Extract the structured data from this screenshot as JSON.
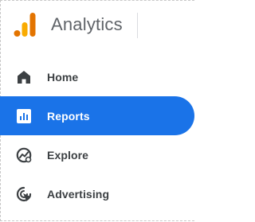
{
  "header": {
    "title": "Analytics",
    "logo_icon": "analytics-logo-icon",
    "logo_colors": [
      "#f9ab00",
      "#e37400"
    ]
  },
  "nav": {
    "items": [
      {
        "label": "Home",
        "icon": "home-icon",
        "active": false
      },
      {
        "label": "Reports",
        "icon": "reports-icon",
        "active": true
      },
      {
        "label": "Explore",
        "icon": "explore-icon",
        "active": false
      },
      {
        "label": "Advertising",
        "icon": "advertising-icon",
        "active": false
      }
    ]
  },
  "colors": {
    "accent": "#1a73e8",
    "text": "#3c4043",
    "icon": "#5f6368"
  }
}
